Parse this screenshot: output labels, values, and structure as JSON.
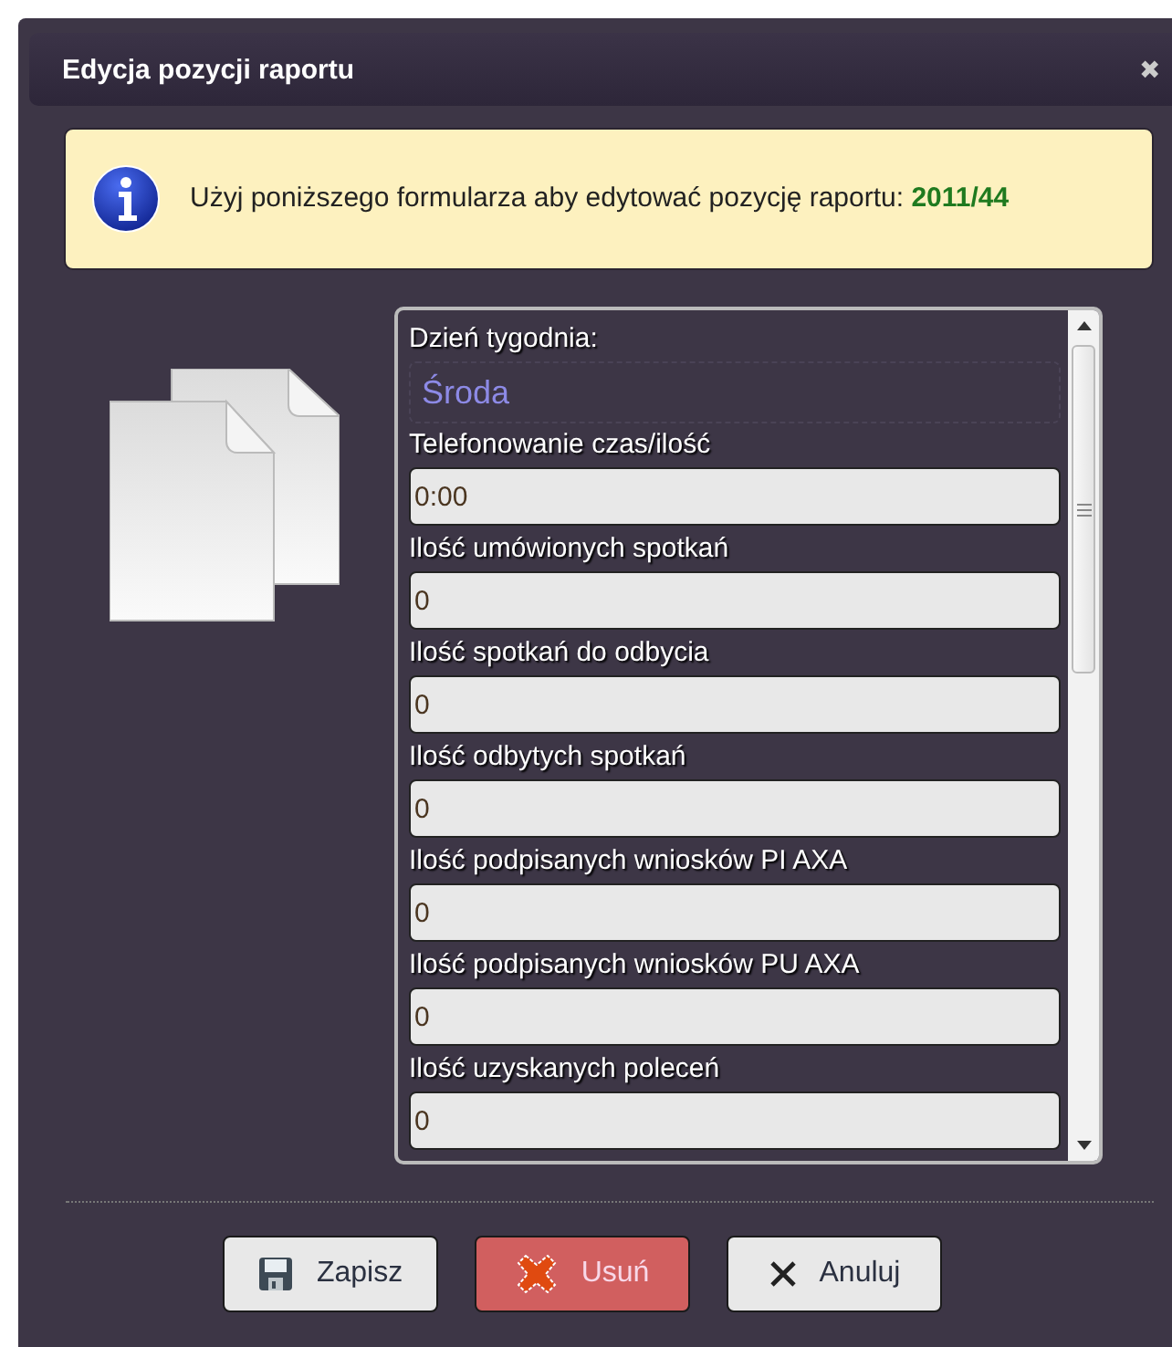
{
  "window": {
    "title": "Edycja pozycji raportu",
    "close": "✖"
  },
  "info": {
    "message": "Użyj poniższego formularza aby edytować pozycję raportu: **2011/44**"
  },
  "form": {
    "fields": [
      {
        "kind": "display",
        "label": "Dzień tygodnia:",
        "value": "Środa"
      },
      {
        "kind": "input",
        "label": "Telefonowanie czas/ilość",
        "value": "0:00"
      },
      {
        "kind": "input",
        "label": "Ilość umówionych spotkań",
        "value": "0"
      },
      {
        "kind": "input",
        "label": "Ilość spotkań do odbycia",
        "value": "0"
      },
      {
        "kind": "input",
        "label": "Ilość odbytych spotkań",
        "value": "0"
      },
      {
        "kind": "input",
        "label": "Ilość podpisanych wniosków PI AXA",
        "value": "0"
      },
      {
        "kind": "input",
        "label": "Ilość podpisanych wniosków PU AXA",
        "value": "0"
      },
      {
        "kind": "input",
        "label": "Ilość uzyskanych poleceń",
        "value": "0"
      }
    ]
  },
  "buttons": [
    {
      "kind": "save",
      "label": "Zapisz"
    },
    {
      "kind": "delete",
      "label": "Usuń"
    },
    {
      "kind": "cancel",
      "label": "Anuluj"
    }
  ]
}
